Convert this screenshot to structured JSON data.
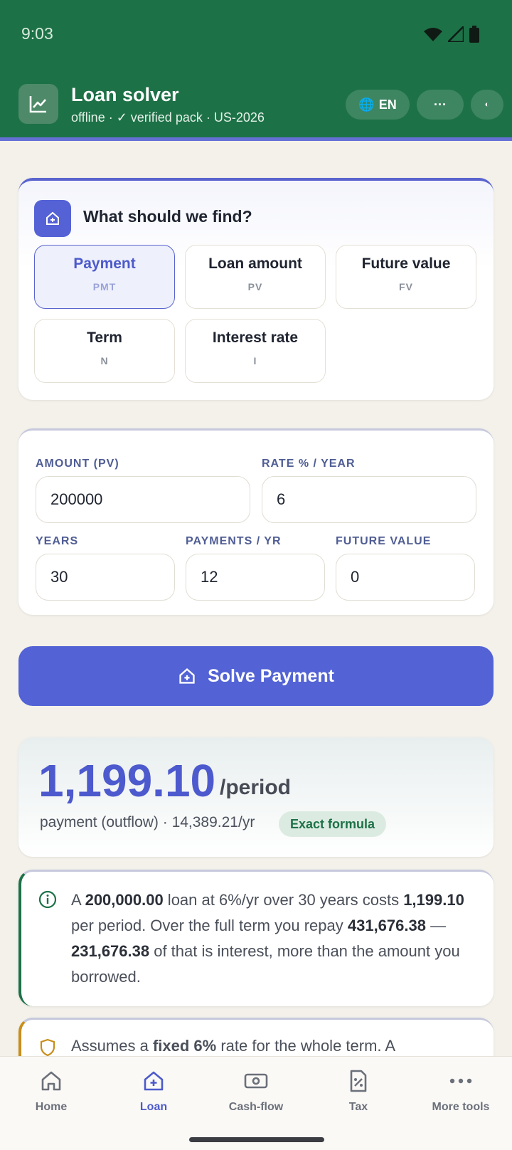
{
  "status": {
    "time": "9:03"
  },
  "header": {
    "title": "Loan solver",
    "subtitle": "offline · ✓ verified pack · US-2026",
    "lang_label": "EN",
    "more_label": "···",
    "theme_label": "◐"
  },
  "find": {
    "title": "What should we find?",
    "options": [
      {
        "label": "Payment",
        "code": "PMT",
        "selected": true
      },
      {
        "label": "Loan amount",
        "code": "PV"
      },
      {
        "label": "Future value",
        "code": "FV"
      },
      {
        "label": "Term",
        "code": "N"
      },
      {
        "label": "Interest rate",
        "code": "I"
      }
    ]
  },
  "inputs": {
    "amount": {
      "label": "AMOUNT (PV)",
      "value": "200000"
    },
    "rate": {
      "label": "RATE % / YEAR",
      "value": "6"
    },
    "years": {
      "label": "YEARS",
      "value": "30"
    },
    "payments": {
      "label": "PAYMENTS / YR",
      "value": "12"
    },
    "future": {
      "label": "FUTURE VALUE",
      "value": "0"
    }
  },
  "solve": {
    "label": "Solve Payment"
  },
  "result": {
    "value": "1,199.10",
    "unit": "/period",
    "desc": "payment (outflow) · 14,389.21/yr",
    "badge": "Exact formula"
  },
  "info": {
    "p1": "A ",
    "b1": "200,000.00",
    "p2": " loan at 6%/yr over 30 years costs ",
    "b2": "1,199.10",
    "p3": " per period. Over the full term you repay ",
    "b3": "431,676.38",
    "p4": " — ",
    "b4": "231,676.38",
    "p5": " of that is interest, more than the amount you borrowed."
  },
  "warning": {
    "p1": "Assumes a ",
    "b1": "fixed 6%",
    "p2": " rate for the whole term. A"
  },
  "nav": [
    {
      "label": "Home"
    },
    {
      "label": "Loan",
      "active": true
    },
    {
      "label": "Cash-flow"
    },
    {
      "label": "Tax"
    },
    {
      "label": "More tools"
    }
  ],
  "colors": {
    "header_green": "#1d7147",
    "accent": "#5363d5",
    "background": "#f3f1ea"
  }
}
